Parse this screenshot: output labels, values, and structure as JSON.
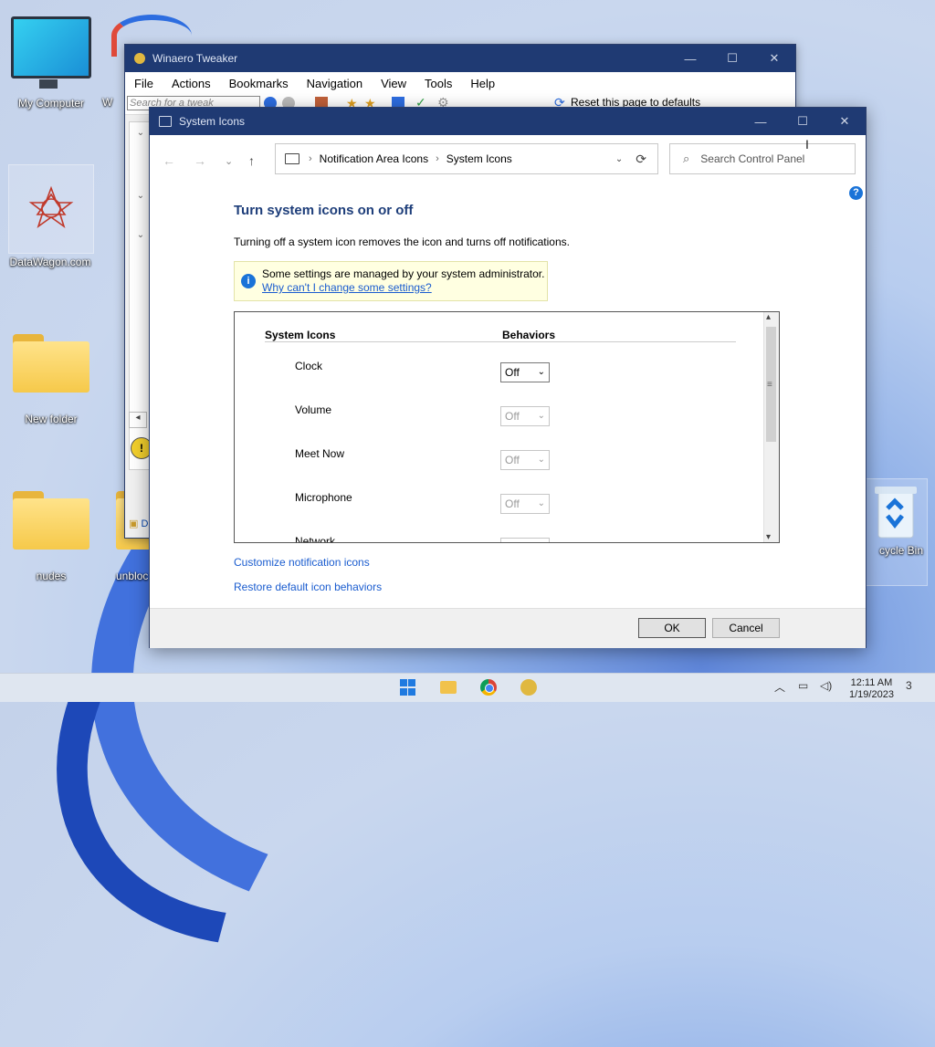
{
  "desktop": {
    "icons": [
      {
        "label": "My Computer"
      },
      {
        "label": "DataWagon.com"
      },
      {
        "label": "New folder"
      },
      {
        "label": "nudes"
      },
      {
        "label": "unbloc"
      },
      {
        "label": "W"
      },
      {
        "label": "cycle Bin"
      }
    ]
  },
  "winaero": {
    "title": "Winaero Tweaker",
    "menu": [
      "File",
      "Actions",
      "Bookmarks",
      "Navigation",
      "View",
      "Tools",
      "Help"
    ],
    "search_placeholder": "Search for a tweak",
    "reset_label": "Reset this page to defaults",
    "status_letter": "D"
  },
  "dialog": {
    "title": "System Icons",
    "breadcrumb": [
      "Notification Area Icons",
      "System Icons"
    ],
    "search_placeholder": "Search Control Panel",
    "heading": "Turn system icons on or off",
    "description": "Turning off a system icon removes the icon and turns off notifications.",
    "admin_notice": "Some settings are managed by your system administrator.",
    "admin_link": "Why can't I change some settings?",
    "columns": {
      "icons": "System Icons",
      "behaviors": "Behaviors"
    },
    "rows": [
      {
        "name": "Clock",
        "value": "Off",
        "enabled": true
      },
      {
        "name": "Volume",
        "value": "Off",
        "enabled": false
      },
      {
        "name": "Meet Now",
        "value": "Off",
        "enabled": false
      },
      {
        "name": "Microphone",
        "value": "Off",
        "enabled": false
      },
      {
        "name": "Network",
        "value": "",
        "enabled": false
      }
    ],
    "links": [
      "Customize notification icons",
      "Restore default icon behaviors"
    ],
    "ok_label": "OK",
    "cancel_label": "Cancel"
  },
  "taskbar": {
    "time": "12:11 AM",
    "date": "1/19/2023",
    "badge": "3"
  },
  "icons": {
    "minimize": "—",
    "maximize": "☐",
    "close": "✕",
    "back": "←",
    "forward": "→",
    "up": "↑",
    "chevron_down": "⌄",
    "refresh": "⟳",
    "search": "⌕",
    "help": "?",
    "info": "i"
  }
}
